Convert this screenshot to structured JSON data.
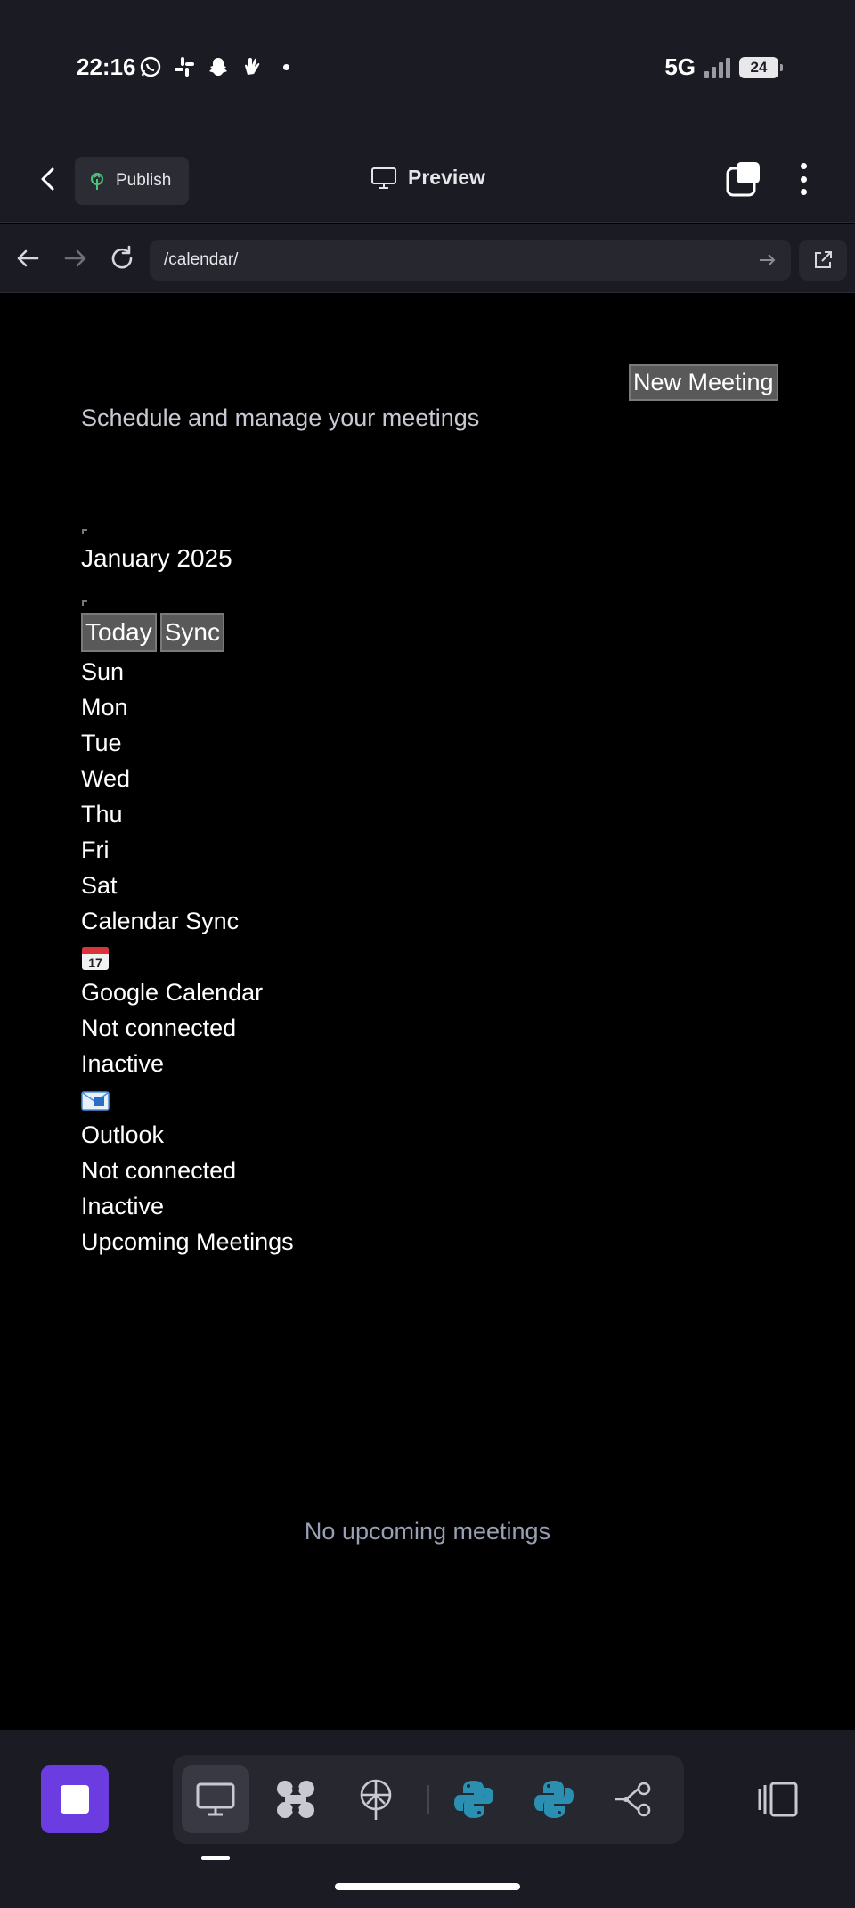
{
  "status_bar": {
    "time": "22:16",
    "network": "5G",
    "battery": "24"
  },
  "app_header": {
    "publish_label": "Publish",
    "preview_label": "Preview"
  },
  "url_bar": {
    "url": "/calendar/"
  },
  "page": {
    "new_meeting_label": "New Meeting",
    "subtitle": "Schedule and manage your meetings",
    "month_label": "January 2025",
    "today_label": "Today",
    "sync_label": "Sync",
    "weekdays": [
      "Sun",
      "Mon",
      "Tue",
      "Wed",
      "Thu",
      "Fri",
      "Sat"
    ],
    "calendar_sync_title": "Calendar Sync",
    "google": {
      "name": "Google Calendar",
      "connection": "Not connected",
      "status": "Inactive"
    },
    "outlook": {
      "name": "Outlook",
      "connection": "Not connected",
      "status": "Inactive"
    },
    "upcoming_title": "Upcoming Meetings",
    "empty_text": "No upcoming meetings"
  },
  "colors": {
    "accent": "#6b3de0",
    "python_blue": "#2a8fb0",
    "button_gray": "#595959"
  }
}
